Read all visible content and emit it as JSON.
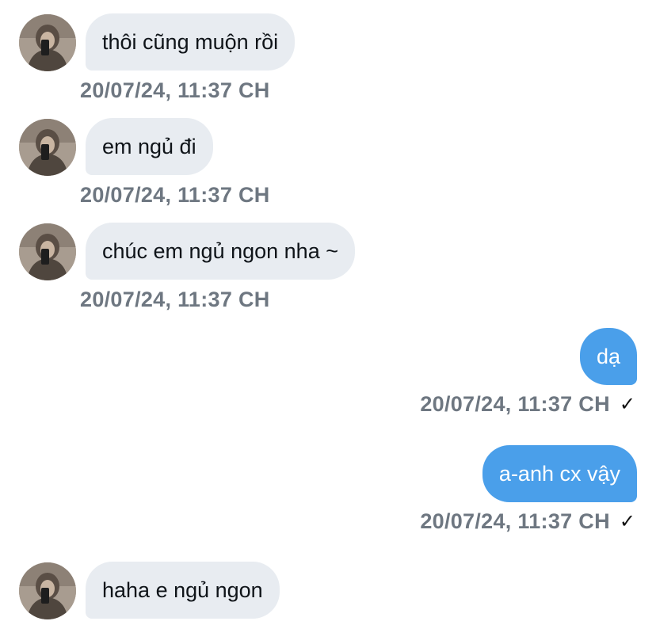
{
  "messages": [
    {
      "direction": "in",
      "text": "thôi cũng muộn rồi",
      "timestamp": "20/07/24, 11:37 CH"
    },
    {
      "direction": "in",
      "text": "em ngủ đi",
      "timestamp": "20/07/24, 11:37 CH"
    },
    {
      "direction": "in",
      "text": "chúc em ngủ ngon nha ~",
      "timestamp": "20/07/24, 11:37 CH"
    },
    {
      "direction": "out",
      "text": "dạ",
      "timestamp": "20/07/24, 11:37 CH",
      "status_icon": "checkmark-icon",
      "status_glyph": "✓"
    },
    {
      "direction": "out",
      "text": "a-anh cx vậy",
      "timestamp": "20/07/24, 11:37 CH",
      "status_icon": "checkmark-icon",
      "status_glyph": "✓"
    },
    {
      "direction": "in",
      "text": "haha e ngủ ngon"
    }
  ],
  "colors": {
    "incoming_bubble": "#e8ecf1",
    "outgoing_bubble": "#4a9fea",
    "timestamp": "#6e7781"
  }
}
